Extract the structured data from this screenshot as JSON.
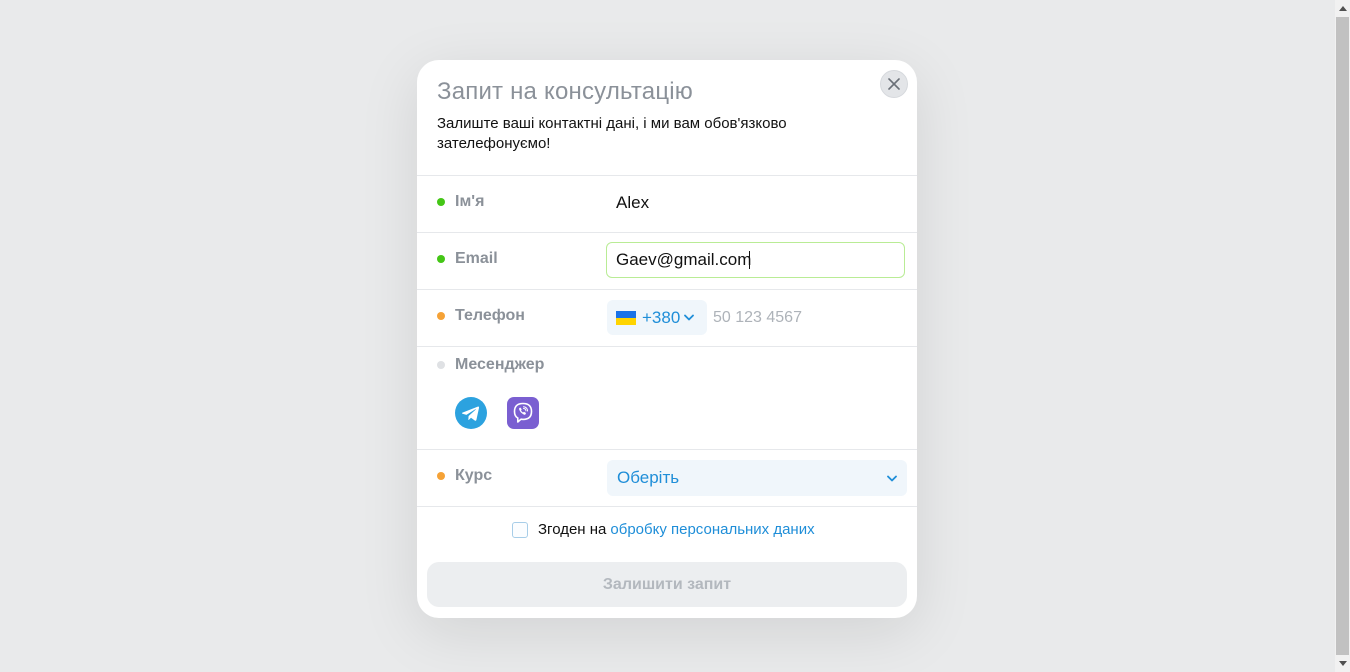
{
  "modal": {
    "title": "Запит на консультацію",
    "subtitle": "Залиште ваші контактні дані, і ми вам обов'язково зателефонуємо!",
    "close_icon": "close-icon"
  },
  "form": {
    "name": {
      "label": "Ім'я",
      "value": "Alex",
      "status_color": "#44c616"
    },
    "email": {
      "label": "Email",
      "value": "Gaev@gmail.com",
      "status_color": "#44c616"
    },
    "phone": {
      "label": "Телефон",
      "country_code": "+380",
      "country_flag": "ukraine-flag-icon",
      "placeholder": "50 123 4567",
      "value": "",
      "status_color": "#f5a237"
    },
    "messenger": {
      "label": "Месенджер",
      "status_color": "#dfe1e4",
      "options": [
        "telegram-icon",
        "viber-icon"
      ]
    },
    "course": {
      "label": "Курс",
      "selected": "Оберіть",
      "status_color": "#f5a237"
    },
    "consent": {
      "checked": false,
      "text": "Згоден на",
      "link_text": "обробку персональних даних"
    },
    "submit_label": "Залишити запит"
  },
  "colors": {
    "accent": "#1f8ed8",
    "valid": "#44c616",
    "warning": "#f5a237",
    "telegram": "#2ca2df",
    "viber": "#7a5fd1"
  }
}
